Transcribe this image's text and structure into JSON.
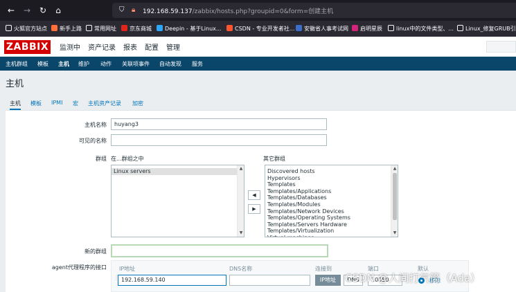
{
  "browser": {
    "url_host": "192.168.59.137",
    "url_path": "/zabbix/hosts.php?groupid=0&form=创建主机",
    "bookmarks": [
      {
        "label": "火狐官方站点",
        "color": "#ffffff"
      },
      {
        "label": "新手上路",
        "color": "#ff7139"
      },
      {
        "label": "常用网址",
        "color": "#ffffff"
      },
      {
        "label": "京东商城",
        "color": "#e1251b"
      },
      {
        "label": "Deepin - 基于Linux...",
        "color": "#2ca7f8"
      },
      {
        "label": "CSDN - 专业开发者社...",
        "color": "#fc5531"
      },
      {
        "label": "安徽省人事考试网",
        "color": "#3b6dc9"
      },
      {
        "label": "启明星辰",
        "color": "#d4237a"
      },
      {
        "label": "linux中的文件类型、...",
        "color": "#ffffff"
      },
      {
        "label": "Linux_修复GRUB引导",
        "color": "#ffffff"
      }
    ]
  },
  "zabbix": {
    "logo": "ZABBIX",
    "main_menu": [
      "监测中",
      "资产记录",
      "报表",
      "配置",
      "管理"
    ],
    "sub_menu": [
      "主机群组",
      "模板",
      "主机",
      "维护",
      "动作",
      "关联项事件",
      "自动发现",
      "服务"
    ],
    "active_sub": "主机",
    "page_title": "主机"
  },
  "form": {
    "tabs": [
      "主机",
      "模板",
      "IPMI",
      "宏",
      "主机资产记录",
      "加密"
    ],
    "active_tab": "主机",
    "host_name_label": "主机名称",
    "host_name_value": "huyang3",
    "visible_name_label": "可见的名称",
    "visible_name_value": "",
    "groups_label": "群组",
    "in_groups_label": "在...群组之中",
    "other_groups_label": "其它群组",
    "in_groups": [
      "Linux servers"
    ],
    "other_groups": [
      "Discovered hosts",
      "Hypervisors",
      "Templates",
      "Templates/Applications",
      "Templates/Databases",
      "Templates/Modules",
      "Templates/Network Devices",
      "Templates/Operating Systems",
      "Templates/Servers Hardware",
      "Templates/Virtualization",
      "Virtual machines"
    ],
    "move_left": "◀",
    "move_right": "▶",
    "new_group_label": "新的群组",
    "new_group_value": "",
    "agent_interfaces_label": "agent代理程序的接口",
    "iface_headers": {
      "ip": "IP地址",
      "dns": "DNS名称",
      "connect": "连接到",
      "port": "端口",
      "default": "默认"
    },
    "iface_ip_value": "192.168.59.140",
    "iface_dns_value": "",
    "connect_ip_btn": "IP地址",
    "connect_dns_btn": "DNS",
    "port_value": "10050",
    "remove_link": "移除"
  },
  "watermark": "CSDN @人间打气筒（Ada）"
}
